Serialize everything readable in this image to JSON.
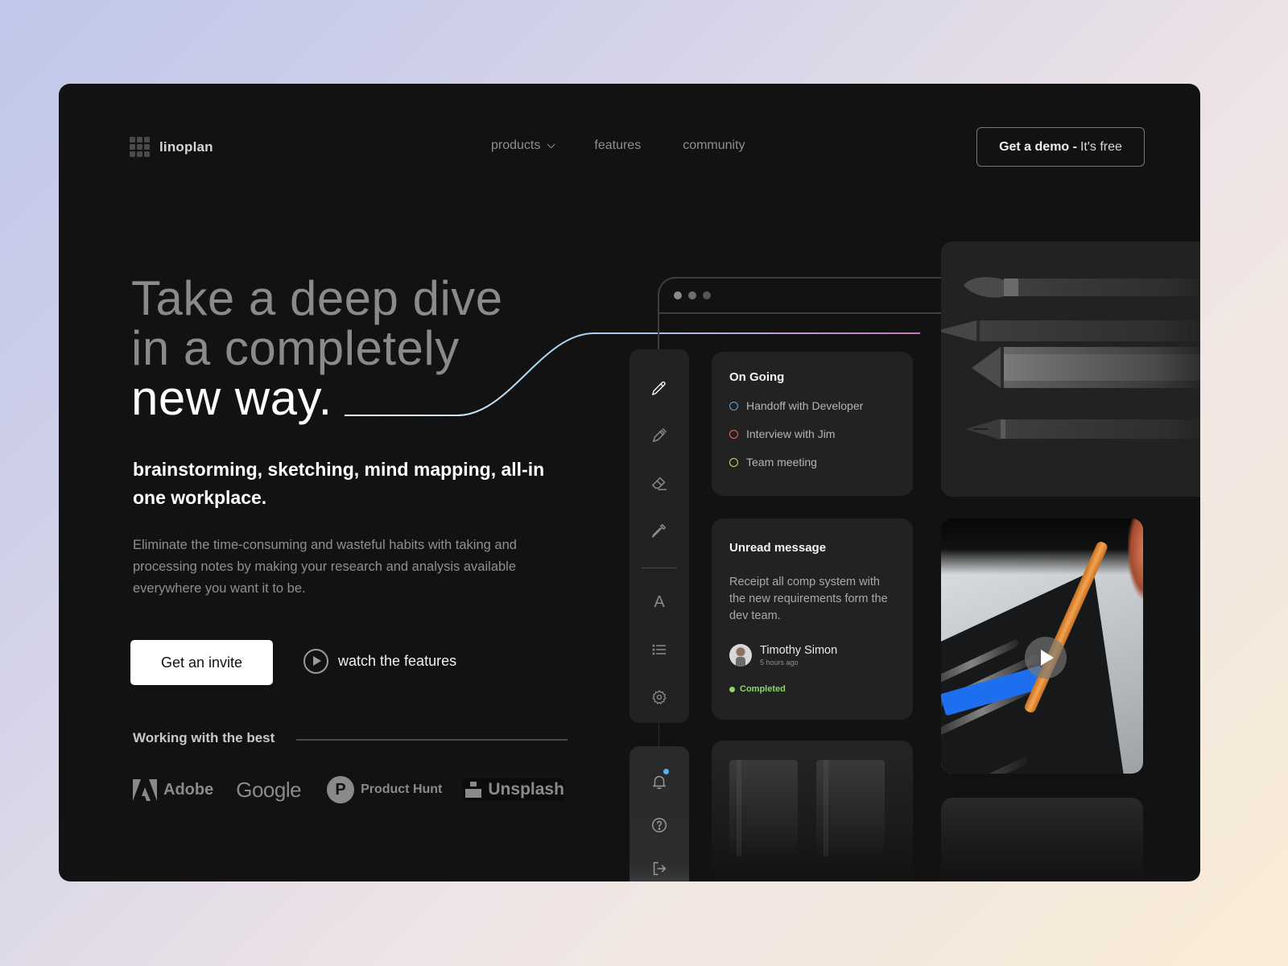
{
  "brand": {
    "name": "linoplan",
    "logo_icon": "grid-logo-icon"
  },
  "nav": {
    "items": [
      {
        "label": "products",
        "has_dropdown": true
      },
      {
        "label": "features",
        "has_dropdown": false
      },
      {
        "label": "community",
        "has_dropdown": false
      }
    ],
    "cta": {
      "bold": "Get a demo -",
      "light": "It's free"
    }
  },
  "hero": {
    "title_line1": "Take a deep dive",
    "title_line2": "in a completely",
    "title_line3": "new way.",
    "subtitle": "brainstorming, sketching, mind mapping, all-in one workplace.",
    "description": "Eliminate the time-consuming and wasteful habits with taking and processing notes by making your research and analysis available everywhere you want it to be.",
    "primary_button": "Get an invite",
    "secondary_button": "watch the features"
  },
  "partners": {
    "label": "Working with the best",
    "logos": [
      "Adobe",
      "Google",
      "Product Hunt",
      "Unsplash"
    ],
    "ph_letter": "P"
  },
  "toolbar": {
    "tools": [
      "pencil-icon",
      "pen-icon",
      "eraser-icon",
      "eyedropper-icon",
      "text-icon",
      "list-icon",
      "settings-icon"
    ],
    "text_tool_glyph": "A",
    "secondary": [
      "bell-icon",
      "help-icon",
      "logout-icon"
    ],
    "notification_dot_color": "#4fb3f5"
  },
  "ongoing_card": {
    "title": "On Going",
    "tasks": [
      {
        "label": "Handoff with Developer",
        "color": "#5aa7e0"
      },
      {
        "label": "Interview with Jim",
        "color": "#e06a6a"
      },
      {
        "label": "Team meeting",
        "color": "#e3d46a"
      }
    ]
  },
  "unread_card": {
    "title": "Unread message",
    "body": "Receipt all comp system with the new requirements form the dev team.",
    "author": "Timothy Simon",
    "time": "5 hours ago",
    "status": "Completed",
    "status_color": "#8fd56b"
  },
  "colors": {
    "frame_bg": "#121212",
    "card_bg": "#222222",
    "accent_curve_start": "#a9d8f5",
    "accent_curve_end": "#c27ab8"
  }
}
